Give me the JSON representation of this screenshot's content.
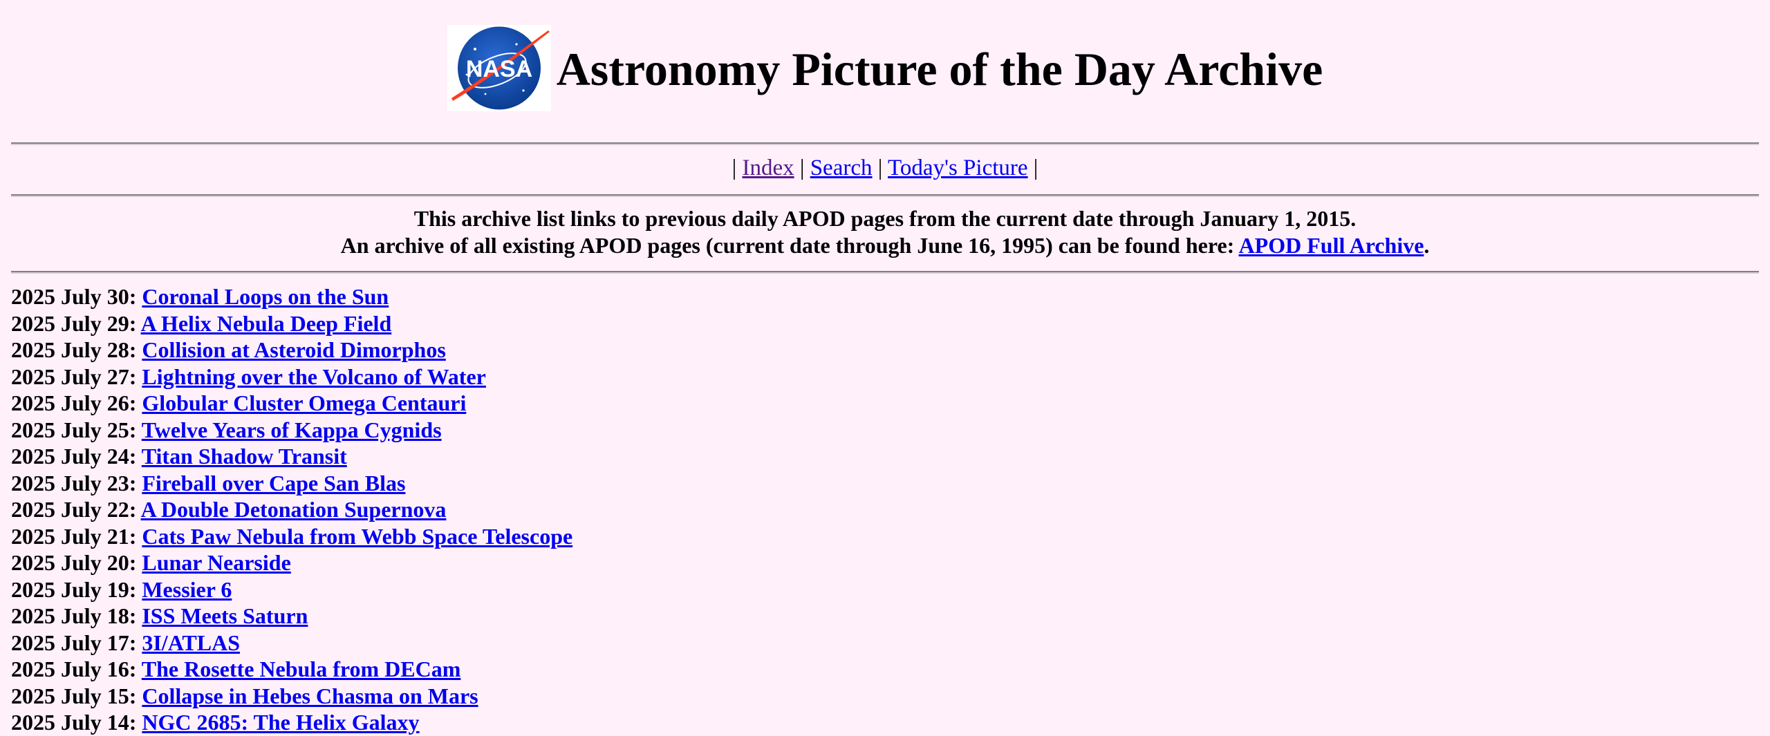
{
  "header": {
    "logo_text": "NASA",
    "title": "Astronomy Picture of the Day Archive"
  },
  "nav": {
    "separator": "|",
    "index": "Index",
    "search": "Search",
    "today": "Today's Picture"
  },
  "intro": {
    "line1": "This archive list links to previous daily APOD pages from the current date through January 1, 2015.",
    "line2_prefix": "An archive of all existing APOD pages (current date through June 16, 1995) can be found here: ",
    "full_archive_link": "APOD Full Archive",
    "line2_suffix": "."
  },
  "entries": [
    {
      "date": "2025 July 30:",
      "title": "Coronal Loops on the Sun"
    },
    {
      "date": "2025 July 29:",
      "title": "A Helix Nebula Deep Field"
    },
    {
      "date": "2025 July 28:",
      "title": "Collision at Asteroid Dimorphos"
    },
    {
      "date": "2025 July 27:",
      "title": "Lightning over the Volcano of Water"
    },
    {
      "date": "2025 July 26:",
      "title": "Globular Cluster Omega Centauri"
    },
    {
      "date": "2025 July 25:",
      "title": "Twelve Years of Kappa Cygnids"
    },
    {
      "date": "2025 July 24:",
      "title": "Titan Shadow Transit"
    },
    {
      "date": "2025 July 23:",
      "title": "Fireball over Cape San Blas"
    },
    {
      "date": "2025 July 22:",
      "title": "A Double Detonation Supernova"
    },
    {
      "date": "2025 July 21:",
      "title": "Cats Paw Nebula from Webb Space Telescope"
    },
    {
      "date": "2025 July 20:",
      "title": "Lunar Nearside"
    },
    {
      "date": "2025 July 19:",
      "title": "Messier 6"
    },
    {
      "date": "2025 July 18:",
      "title": "ISS Meets Saturn"
    },
    {
      "date": "2025 July 17:",
      "title": "3I/ATLAS"
    },
    {
      "date": "2025 July 16:",
      "title": "The Rosette Nebula from DECam"
    },
    {
      "date": "2025 July 15:",
      "title": "Collapse in Hebes Chasma on Mars"
    },
    {
      "date": "2025 July 14:",
      "title": "NGC 2685: The Helix Galaxy"
    }
  ]
}
